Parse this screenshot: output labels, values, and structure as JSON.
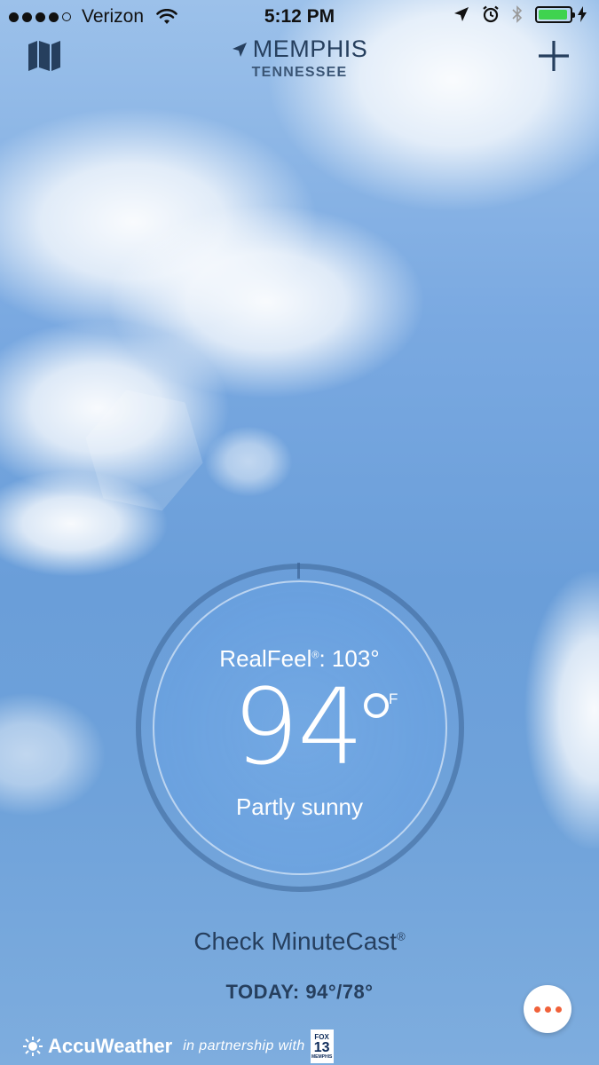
{
  "status_bar": {
    "carrier": "Verizon",
    "time": "5:12 PM",
    "signal_bars_filled": 4,
    "signal_bars_total": 5,
    "battery_level": 0.85,
    "icons": [
      "wifi-icon",
      "location-arrow-icon",
      "alarm-icon",
      "bluetooth-icon",
      "battery-icon",
      "charging-bolt-icon"
    ]
  },
  "header": {
    "city": "MEMPHIS",
    "state": "TENNESSEE",
    "map_icon": "map-icon",
    "add_icon": "plus-icon",
    "location_icon": "location-arrow-icon"
  },
  "current": {
    "realfeel_label": "RealFeel",
    "realfeel_mark": "®",
    "realfeel_value": ": 103°",
    "temperature": "94",
    "unit": "F",
    "condition": "Partly sunny"
  },
  "bottom": {
    "minutecast_label": "Check MinuteCast",
    "minutecast_mark": "®",
    "today": "TODAY: 94°/78°",
    "more_icon": "more-dots-icon"
  },
  "footer": {
    "brand": "AccuWeather",
    "partner_text": "in partnership with",
    "partner_logo_line1": "FOX",
    "partner_logo_line2": "13",
    "partner_logo_line3": "MEMPHIS"
  },
  "colors": {
    "sky_top": "#9cc1ea",
    "sky_mid": "#6a9ed9",
    "header_text": "#263f5e",
    "accent_dots": "#f0613a",
    "battery": "#3fd34f"
  }
}
